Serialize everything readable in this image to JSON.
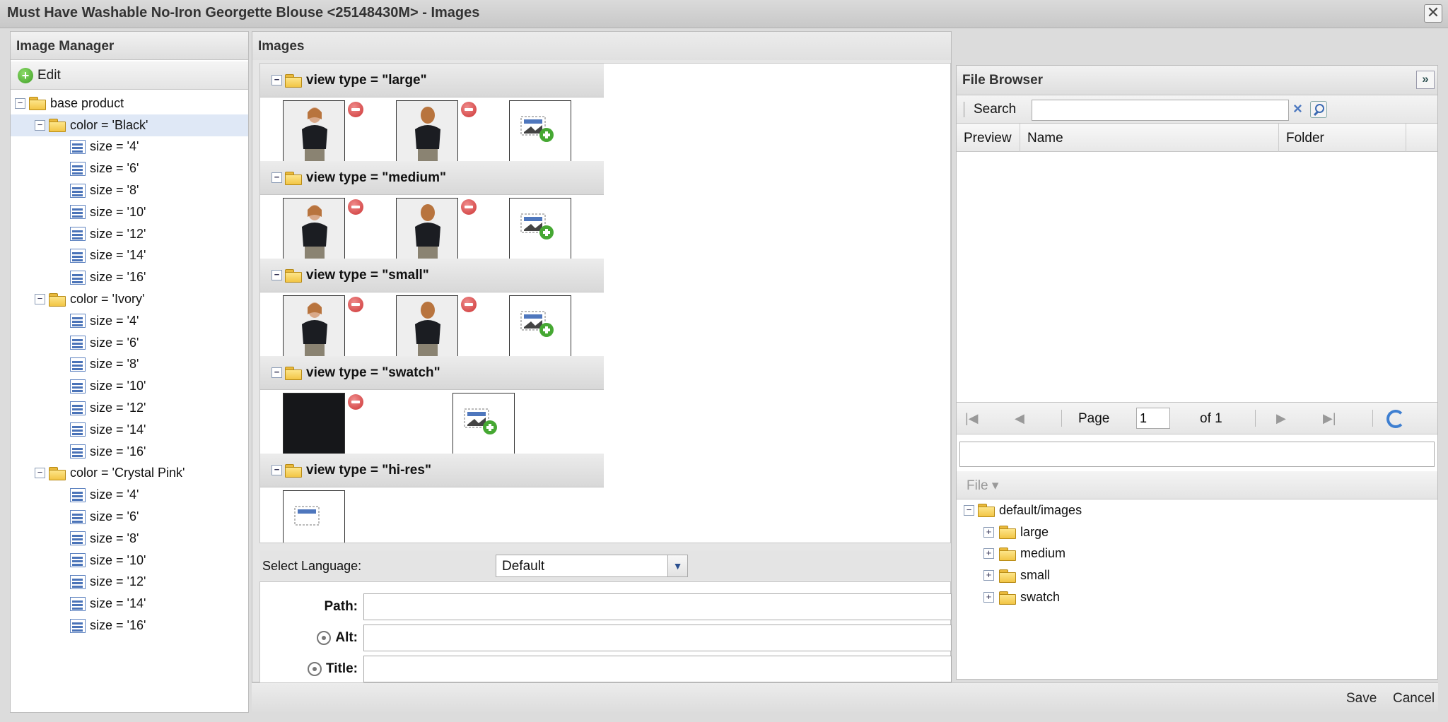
{
  "window": {
    "title": "Must Have Washable No-Iron Georgette Blouse <25148430M> - Images",
    "close_label": "✕"
  },
  "image_manager": {
    "title": "Image Manager",
    "edit_label": "Edit",
    "tree": {
      "root": "base product",
      "colors": [
        {
          "label": "color = 'Black'",
          "sizes": [
            "size = '4'",
            "size = '6'",
            "size = '8'",
            "size = '10'",
            "size = '12'",
            "size = '14'",
            "size = '16'"
          ]
        },
        {
          "label": "color = 'Ivory'",
          "sizes": [
            "size = '4'",
            "size = '6'",
            "size = '8'",
            "size = '10'",
            "size = '12'",
            "size = '14'",
            "size = '16'"
          ]
        },
        {
          "label": "color = 'Crystal Pink'",
          "sizes": [
            "size = '4'",
            "size = '6'",
            "size = '8'",
            "size = '10'",
            "size = '12'",
            "size = '14'",
            "size = '16'"
          ]
        }
      ]
    }
  },
  "images": {
    "title": "Images",
    "view_types": [
      {
        "label": "view type = \"large\""
      },
      {
        "label": "view type = \"medium\""
      },
      {
        "label": "view type = \"small\""
      },
      {
        "label": "view type = \"swatch\""
      },
      {
        "label": "view type = \"hi-res\""
      }
    ],
    "select_language_label": "Select Language:",
    "language_value": "Default",
    "path_label": "Path:",
    "alt_label": "Alt:",
    "title_label": "Title:",
    "path_value": "",
    "alt_value": "",
    "title_value": ""
  },
  "file_browser": {
    "title": "File Browser",
    "collapse_label": "»",
    "search_label": "Search",
    "search_value": "",
    "columns": [
      "Preview",
      "Name",
      "Folder"
    ],
    "pager": {
      "page_label": "Page",
      "page_value": "1",
      "of_label": "of 1"
    },
    "file_menu_label": "File ▾",
    "tree": {
      "root": "default/images",
      "children": [
        "large",
        "medium",
        "small",
        "swatch"
      ]
    }
  },
  "footer": {
    "save_label": "Save",
    "cancel_label": "Cancel"
  },
  "colors": {
    "accent_blue": "#4d79c0",
    "selected_row": "#dfe8f6",
    "remove_red": "#cc3434",
    "add_green": "#3c9e24"
  }
}
